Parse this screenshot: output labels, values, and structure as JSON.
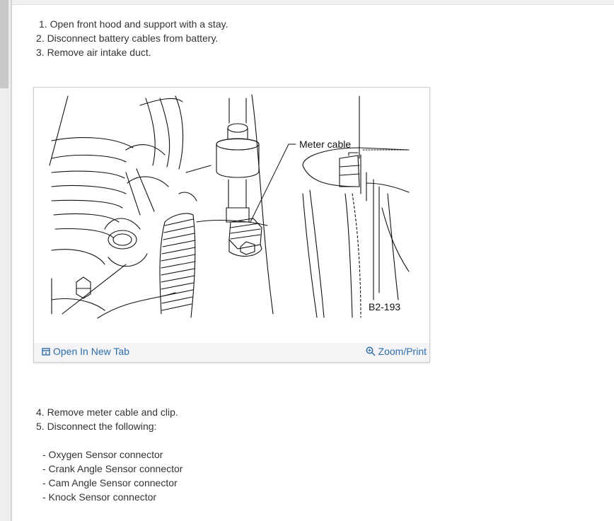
{
  "steps_top": [
    "1. Open front hood and support with a stay.",
    "2. Disconnect battery cables from battery.",
    "3. Remove air intake duct."
  ],
  "figure": {
    "callout": "Meter cable",
    "code": "B2-193",
    "open_tab_label": "Open In New Tab",
    "zoom_label": "Zoom/Print"
  },
  "steps_bottom": [
    "4. Remove meter cable and clip.",
    "5. Disconnect the following:"
  ],
  "connectors": [
    "-  Oxygen Sensor connector",
    "-  Crank Angle Sensor connector",
    "-  Cam Angle Sensor connector",
    "-  Knock Sensor connector"
  ],
  "colors": {
    "link": "#2f6ea8",
    "text": "#333333"
  }
}
